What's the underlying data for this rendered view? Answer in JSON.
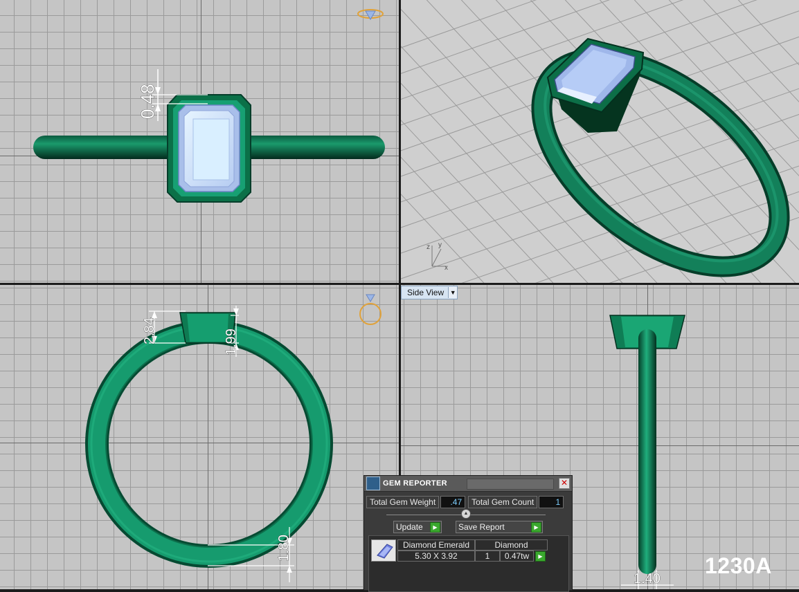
{
  "viewports": {
    "top": {
      "dimension": "0.48"
    },
    "front": {
      "dim_height": "2.84",
      "dim_thickness": "1.99",
      "dim_band": "1.80"
    },
    "side": {
      "label": "Side View",
      "dim_width": "1.40"
    },
    "perspective": {
      "axes": {
        "z": "z",
        "y": "y",
        "x": "x"
      }
    }
  },
  "gem_reporter": {
    "title": "GEM REPORTER",
    "total_gem_weight_label": "Total Gem Weight",
    "total_gem_weight_value": ".47",
    "total_gem_count_label": "Total Gem Count",
    "total_gem_count_value": "1",
    "update_label": "Update",
    "save_report_label": "Save Report",
    "gem": {
      "shape": "Diamond Emerald",
      "type": "Diamond",
      "size": "5.30 X 3.92",
      "count": "1",
      "weight": "0.47tw"
    }
  },
  "model_code": "1230A",
  "colors": {
    "metal": "#0e7a55",
    "metal_dark": "#053d2a",
    "gem": "#b9d3f4",
    "viewport_bg": "#c5c5c5"
  }
}
